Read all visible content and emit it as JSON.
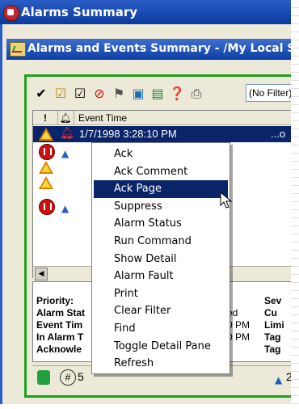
{
  "window": {
    "title": "Alarms Summary"
  },
  "subwindow": {
    "title": "Alarms and Events Summary - /My Local Site"
  },
  "toolbar": {
    "filter_value": "(No Filter)"
  },
  "columns": [
    "!",
    "Event Time"
  ],
  "selected_row": {
    "event_time": "1/7/1998 3:28:10 PM",
    "trailing": "...o"
  },
  "menu": {
    "items": [
      "Ack",
      "Ack Comment",
      "Ack Page",
      "Suppress",
      "Alarm Status",
      "Run Command",
      "Show Detail",
      "Alarm Fault",
      "Print",
      "Clear Filter",
      "Find",
      "Toggle Detail Pane",
      "Refresh"
    ],
    "highlighted": "Ack Page"
  },
  "details": {
    "labels": [
      "Priority:",
      "Alarm Stat",
      "Event Tim",
      "In Alarm T",
      "Acknowle"
    ],
    "mid": [
      "",
      "ked",
      ":10 PM",
      ":10 PM",
      ""
    ],
    "right": [
      "Sev",
      "Cu",
      "Limi",
      "Tag",
      "Tag"
    ]
  },
  "statusbar": {
    "count_prefix": "#",
    "count": "5",
    "count_right": "2"
  }
}
